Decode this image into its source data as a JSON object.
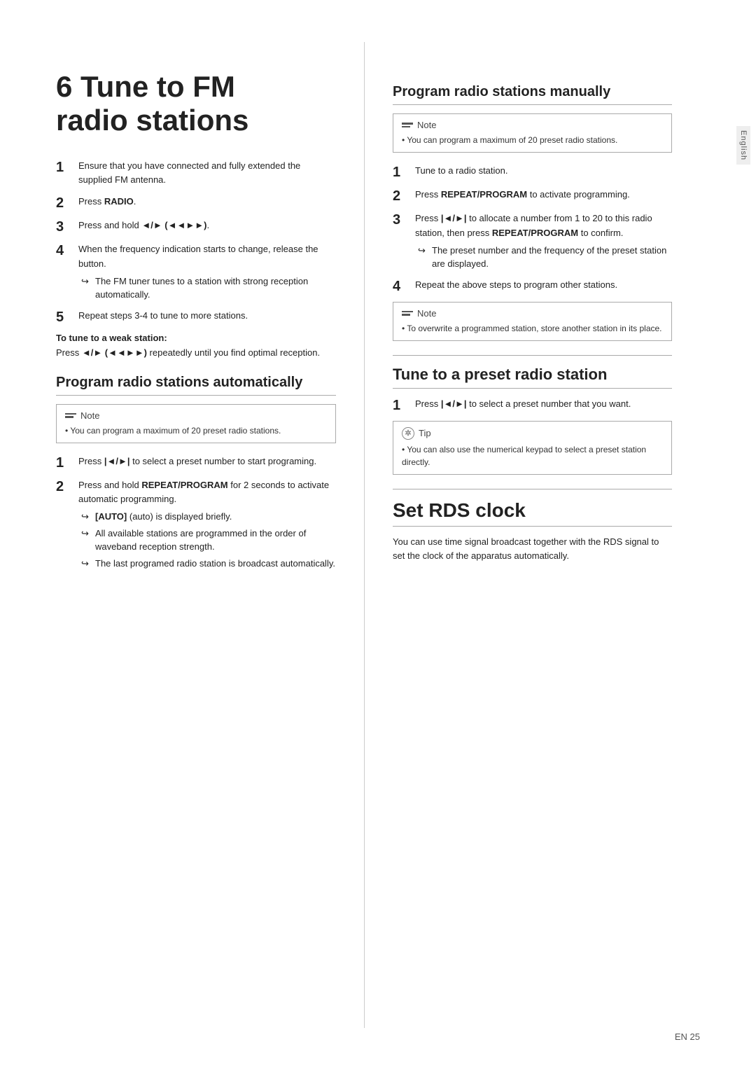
{
  "page": {
    "chapter_number": "6",
    "chapter_title": "Tune to FM\nradio stations",
    "left_col": {
      "intro_steps": [
        {
          "num": "1",
          "text": "Ensure that you have connected and fully extended the supplied FM antenna."
        },
        {
          "num": "2",
          "text": "Press RADIO."
        },
        {
          "num": "3",
          "text": "Press and hold ◄/► (◄◄►►)."
        },
        {
          "num": "4",
          "text": "When the frequency indication starts to change, release the button.",
          "arrow": "The FM tuner tunes to a station with strong reception automatically."
        },
        {
          "num": "5",
          "text": "Repeat steps 3-4 to tune to more stations."
        }
      ],
      "weak_station_label": "To tune to a weak station:",
      "weak_station_text": "Press ◄/► (◄◄►►) repeatedly until you find optimal reception.",
      "auto_section": {
        "title": "Program radio stations automatically",
        "note": {
          "label": "Note",
          "text": "You can program a maximum of 20 preset radio stations."
        },
        "steps": [
          {
            "num": "1",
            "text": "Press |◄/►| to select a preset number to start programing."
          },
          {
            "num": "2",
            "text": "Press and hold REPEAT/PROGRAM for 2 seconds to activate automatic programming.",
            "arrows": [
              "[AUTO] (auto) is displayed briefly.",
              "All available stations are programmed in the order of waveband reception strength.",
              "The last programed radio station is broadcast automatically."
            ]
          }
        ]
      }
    },
    "right_col": {
      "manual_section": {
        "title": "Program radio stations manually",
        "note": {
          "label": "Note",
          "text": "You can program a maximum of 20 preset radio stations."
        },
        "steps": [
          {
            "num": "1",
            "text": "Tune to a radio station."
          },
          {
            "num": "2",
            "text": "Press REPEAT/PROGRAM to activate programming."
          },
          {
            "num": "3",
            "text": "Press |◄/►| to allocate a number from 1 to 20 to this radio station, then press REPEAT/PROGRAM to confirm.",
            "arrow": "The preset number and the frequency of the preset station are displayed."
          },
          {
            "num": "4",
            "text": "Repeat the above steps to program other stations."
          }
        ],
        "note2": {
          "label": "Note",
          "text": "To overwrite a programmed station, store another station in its place."
        }
      },
      "preset_section": {
        "title": "Tune to a preset radio station",
        "steps": [
          {
            "num": "1",
            "text": "Press |◄/►| to select a preset number that you want."
          }
        ],
        "tip": {
          "label": "Tip",
          "text": "You can also use the numerical keypad to select a preset station directly."
        }
      },
      "rds_section": {
        "title": "Set RDS clock",
        "text": "You can use time signal broadcast together with the RDS signal to set the clock of the apparatus automatically."
      }
    },
    "sidebar_label": "English",
    "page_number": "EN  25"
  }
}
